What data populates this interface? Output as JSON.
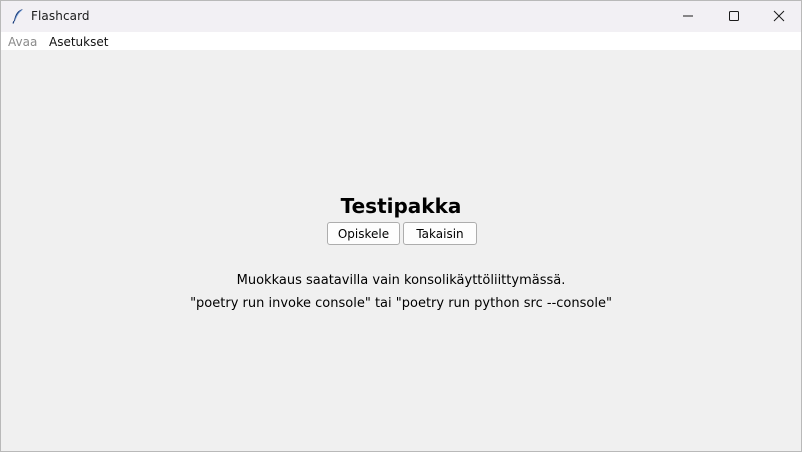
{
  "window": {
    "title": "Flashcard",
    "icon": "feather-icon",
    "controls": [
      "minimize-icon",
      "maximize-icon",
      "close-icon"
    ]
  },
  "menu": {
    "open_label": "Avaa",
    "settings_label": "Asetukset"
  },
  "main": {
    "deck_title": "Testipakka",
    "study_button": "Opiskele",
    "back_button": "Takaisin",
    "info_line_1": "Muokkaus saatavilla vain konsolikäyttöliittymässä.",
    "info_line_2": "\"poetry run invoke console\" tai \"poetry run python src --console\""
  },
  "colors": {
    "background": "#f0f0f0",
    "titlebar": "#f2f0f4",
    "menubar": "#ffffff",
    "disabled_menu": "#8a8a8a"
  }
}
